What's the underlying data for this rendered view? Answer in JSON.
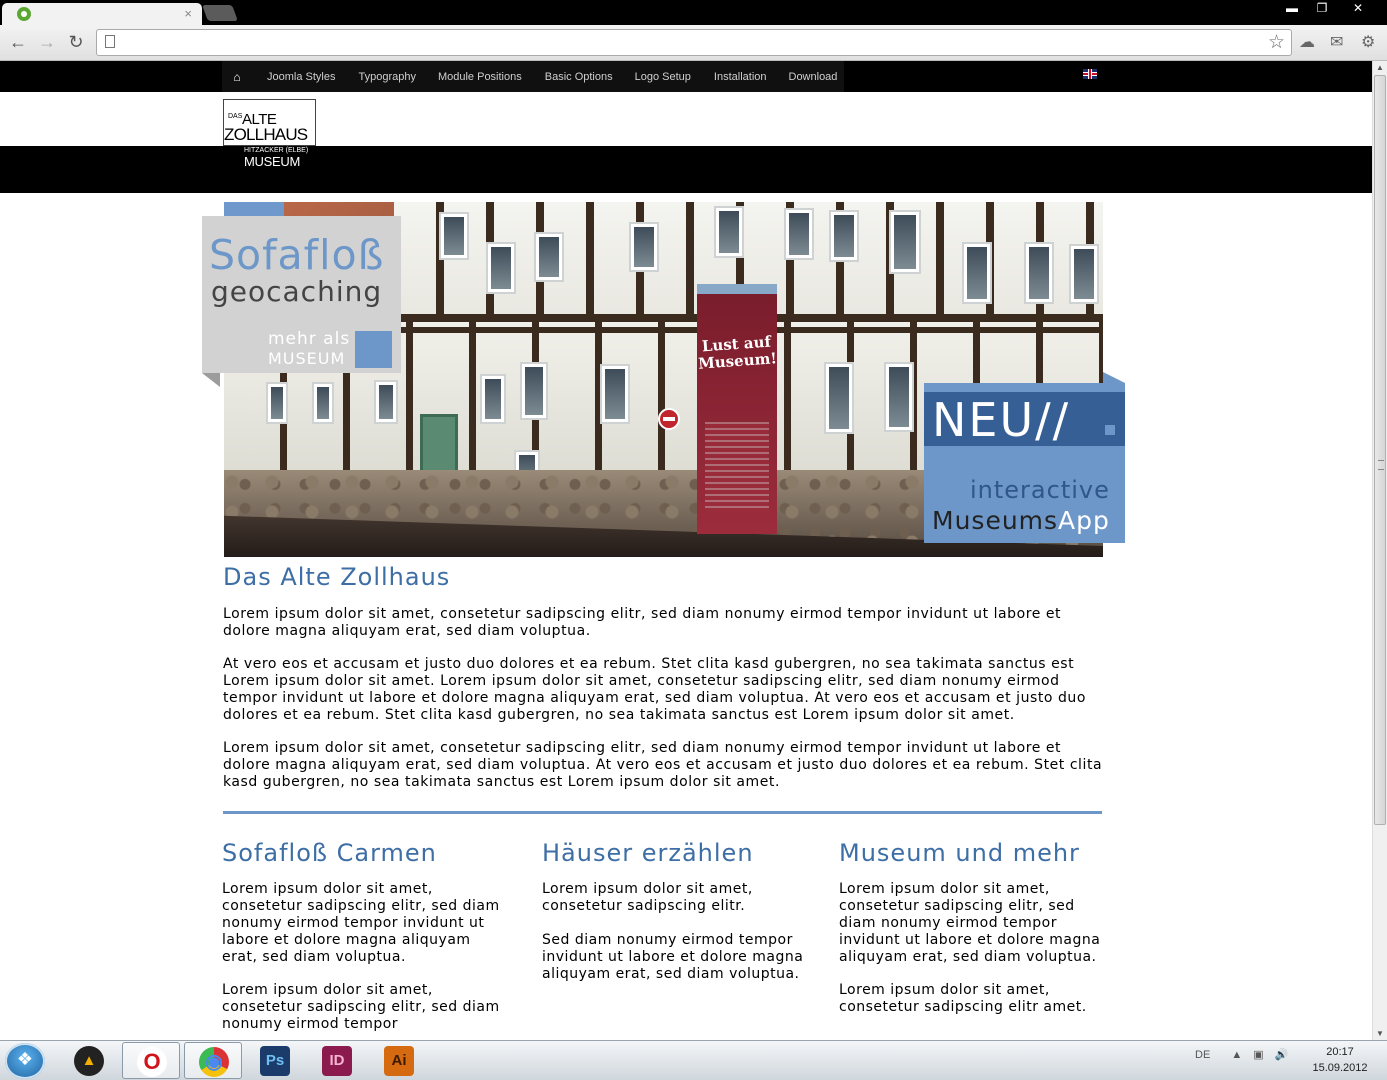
{
  "browser": {
    "tab_title": "",
    "tab_close": "×",
    "address": "",
    "window_buttons": [
      "▬",
      "❐",
      "✕"
    ]
  },
  "site": {
    "nav": {
      "home_icon": "home-icon",
      "items": [
        "Joomla Styles",
        "Typography",
        "Module Positions",
        "Basic Options",
        "Logo Setup",
        "Installation",
        "Download"
      ]
    },
    "logo": {
      "das": "DAS",
      "alte": "ALTE",
      "zollhaus": "ZOLLHAUS",
      "hitzacker": "HITZACKER (ELBE)",
      "museum": "MUSEUM"
    },
    "hero": {
      "banner_text": "Lust auf Museum!",
      "left_title": "Sofafloß",
      "left_subtitle": "geocaching",
      "left_mehr": "mehr als",
      "left_museum": "MUSEUM",
      "right_title": "NEU//",
      "right_interactive": "interactive",
      "right_app_a": "Museums",
      "right_app_b": "App"
    },
    "main": {
      "heading": "Das Alte Zollhaus",
      "paragraphs": [
        "Lorem ipsum dolor sit amet, consetetur sadipscing elitr, sed diam nonumy eirmod tempor invidunt ut labore et dolore magna aliquyam erat, sed diam voluptua.",
        "At vero eos et accusam et justo duo dolores et ea rebum. Stet clita kasd gubergren, no sea takimata sanctus est Lorem ipsum dolor sit amet. Lorem ipsum dolor sit amet, consetetur sadipscing elitr, sed diam nonumy eirmod tempor invidunt ut labore et dolore magna aliquyam erat, sed diam voluptua. At vero eos et accusam et justo duo dolores et ea rebum. Stet clita kasd gubergren, no sea takimata sanctus est Lorem ipsum dolor sit amet.",
        "Lorem ipsum dolor sit amet, consetetur sadipscing elitr, sed diam nonumy eirmod tempor invidunt ut labore et dolore magna aliquyam erat, sed diam voluptua. At vero eos et accusam et justo duo dolores et ea rebum. Stet clita kasd gubergren, no sea takimata sanctus est Lorem ipsum dolor sit amet."
      ]
    },
    "columns": [
      {
        "heading": "Sofafloß Carmen",
        "paragraphs": [
          "Lorem ipsum dolor sit amet, consetetur sadipscing elitr, sed diam nonumy eirmod tempor invidunt ut labore et dolore magna aliquyam erat, sed diam voluptua.",
          "Lorem ipsum dolor sit amet, consetetur sadipscing elitr, sed diam nonumy eirmod tempor"
        ]
      },
      {
        "heading": "Häuser erzählen",
        "paragraphs": [
          "Lorem ipsum dolor sit amet, consetetur sadipscing elitr.",
          "Sed diam nonumy eirmod tempor invidunt ut labore et dolore magna aliquyam erat, sed diam voluptua."
        ]
      },
      {
        "heading": "Museum und mehr",
        "paragraphs": [
          "Lorem ipsum dolor sit amet, consetetur sadipscing elitr, sed diam nonumy eirmod tempor invidunt ut labore et dolore magna aliquyam erat, sed diam voluptua.",
          "Lorem ipsum dolor sit amet, consetetur sadipscing elitr amet."
        ]
      }
    ]
  },
  "taskbar": {
    "apps": [
      {
        "name": "ahead",
        "label": "▲",
        "color": "#f2b000"
      },
      {
        "name": "opera",
        "label": "O",
        "color": "#d0141c"
      },
      {
        "name": "chrome",
        "label": "◉",
        "color": "#4a8af0"
      },
      {
        "name": "photoshop",
        "label": "Ps",
        "color": "#1b3b6b"
      },
      {
        "name": "indesign",
        "label": "ID",
        "color": "#8b1a4e"
      },
      {
        "name": "illustrator",
        "label": "Ai",
        "color": "#d66a10"
      }
    ],
    "lang": "DE",
    "time": "20:17",
    "date": "15.09.2012"
  },
  "colors": {
    "accent_blue": "#6d97c9",
    "heading_blue": "#3d6ea5",
    "dark_blue": "#355f95"
  }
}
